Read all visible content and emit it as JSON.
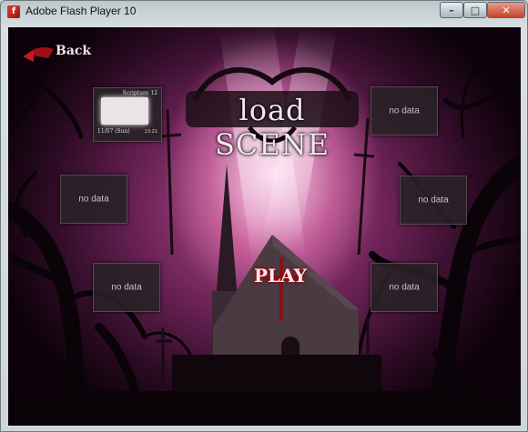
{
  "window": {
    "title": "Adobe Flash Player 10",
    "app_icon_glyph": "f",
    "minimize": "–",
    "maximize": "□",
    "close": "✕"
  },
  "game": {
    "back_label": "Back",
    "heading": "load SCENE",
    "play_label": "PLAY",
    "slots": [
      {
        "id": "left-1",
        "filled": true,
        "name": "Scripture 12",
        "date": "11/07 (Sun)",
        "time": "13:21"
      },
      {
        "id": "left-2",
        "filled": false,
        "label": "no data"
      },
      {
        "id": "left-3",
        "filled": false,
        "label": "no data"
      },
      {
        "id": "right-1",
        "filled": false,
        "label": "no data"
      },
      {
        "id": "right-2",
        "filled": false,
        "label": "no data"
      },
      {
        "id": "right-3",
        "filled": false,
        "label": "no data"
      }
    ]
  },
  "colors": {
    "accent_red": "#cc1122",
    "sky_pink": "#b8558f",
    "slot_bg": "#282226"
  }
}
